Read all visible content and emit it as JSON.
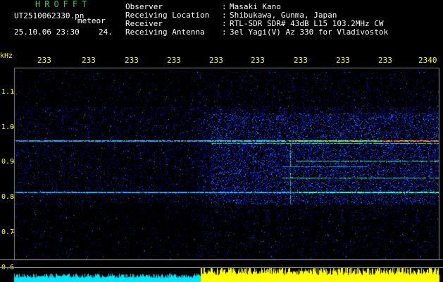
{
  "header": {
    "title": "HROFFT",
    "filename": "UT2510062330.pn",
    "meteor_label": "meteor",
    "datetime": "25.10.06 23:30",
    "count": "24.",
    "info": [
      {
        "label": "Observer",
        "value": "Masaki Kano"
      },
      {
        "label": "Receiving Location",
        "value": "Shibukawa, Gunma, Japan"
      },
      {
        "label": "Receiver",
        "value": "RTL-SDR SDR# 43dB L15 103.2MHz CW"
      },
      {
        "label": "Receiving Antenna",
        "value": "3el Yagi(V) Az 330 for Vladivostok"
      }
    ]
  },
  "axis": {
    "unit": "kHz",
    "time_ticks": [
      "233",
      "233",
      "233",
      "233",
      "233",
      "233",
      "233",
      "233",
      "233",
      "2340"
    ],
    "freq_ticks": [
      "1.1",
      "1.0",
      "0.9",
      "0.8",
      "0.7",
      "0.6"
    ]
  },
  "colors": {
    "title": "#3cc83c",
    "axis_labels": "#ffff00",
    "background_noise": "#0000c8",
    "echo_level_low": "#00ffff",
    "echo_level_high": "#ffff00"
  }
}
